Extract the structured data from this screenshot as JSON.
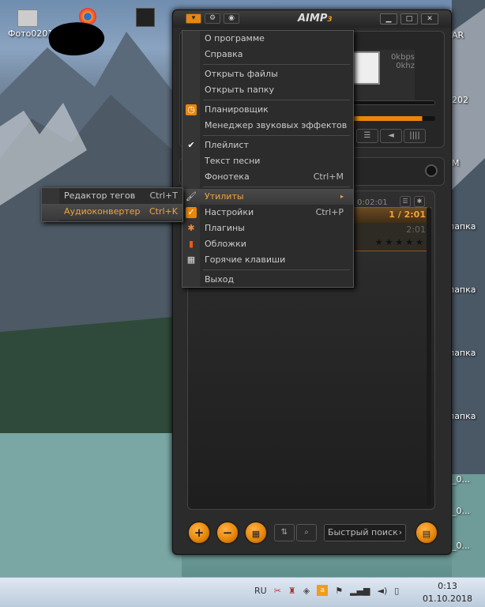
{
  "desktop": {
    "icon_label_photo": "Фото0201",
    "icon_label_obscured": "...",
    "right_labels": [
      "AR",
      "202",
      "М",
      "папка",
      "папка",
      "папка",
      "папка",
      "_0...",
      "_0...",
      "_0..."
    ]
  },
  "aimp": {
    "title": "AIMP",
    "title_version": "3",
    "bitrate": "0kbps",
    "samplerate": "0khz",
    "playlist_time": "0:02:01",
    "track_counter": "1 / 2:01",
    "track_duration": "2:01",
    "search_placeholder": "Быстрый поиск",
    "buttons": {
      "add": "+",
      "remove": "−"
    }
  },
  "main_menu": {
    "items": [
      {
        "label": "О программе"
      },
      {
        "label": "Справка"
      },
      {
        "label": "Открыть файлы"
      },
      {
        "label": "Открыть папку"
      },
      {
        "label": "Планировщик"
      },
      {
        "label": "Менеджер звуковых эффектов"
      },
      {
        "label": "Плейлист",
        "checked": true
      },
      {
        "label": "Текст песни"
      },
      {
        "label": "Фонотека",
        "shortcut": "Ctrl+M"
      },
      {
        "label": "Утилиты",
        "submenu": true
      },
      {
        "label": "Настройки",
        "shortcut": "Ctrl+P"
      },
      {
        "label": "Плагины"
      },
      {
        "label": "Обложки"
      },
      {
        "label": "Горячие клавиши"
      },
      {
        "label": "Выход"
      }
    ]
  },
  "sub_menu": {
    "items": [
      {
        "label": "Редактор тегов",
        "shortcut": "Ctrl+T"
      },
      {
        "label": "Аудиоконвертер",
        "shortcut": "Ctrl+K"
      }
    ]
  },
  "taskbar": {
    "language": "RU",
    "time": "0:13",
    "date": "01.10.2018"
  },
  "colors": {
    "accent": "#f2a33a",
    "window_bg": "#2b2b2b",
    "menu_bg": "#2c2c2c"
  }
}
